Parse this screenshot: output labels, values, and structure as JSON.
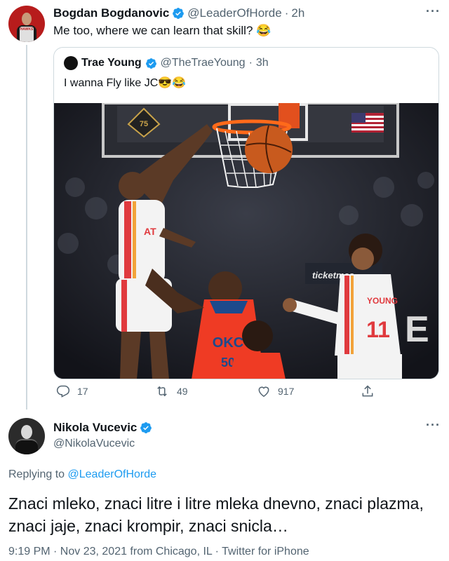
{
  "main_tweet": {
    "display_name": "Bogdan Bogdanovic",
    "handle": "@LeaderOfHorde",
    "dot": "·",
    "time": "2h",
    "text": "Me too, where we can learn that skill? 😂",
    "avatar_jersey": "HAWKS",
    "quoted": {
      "display_name": "Trae Young",
      "handle": "@TheTraeYoung",
      "dot": "·",
      "time": "3h",
      "text": "I wanna Fly like JC😎😂",
      "photo": {
        "backboard_logo": "75",
        "scoreboard_text": "ticketmas",
        "signage_letter": "E",
        "hawks_left_jersey": "AT",
        "okc_jersey_team": "OKC",
        "okc_jersey_number": "50",
        "young_name": "YOUNG",
        "young_number": "11"
      }
    },
    "actions": {
      "reply_count": "17",
      "retweet_count": "49",
      "like_count": "917"
    }
  },
  "reply_tweet": {
    "display_name": "Nikola Vucevic",
    "handle": "@NikolaVucevic",
    "replying_prefix": "Replying to",
    "replying_mention": "@LeaderOfHorde",
    "text": "Znaci mleko, znaci litre i litre mleka dnevno, znaci plazma, znaci jaje, znaci krompir, znaci snicla…",
    "meta": "9:19 PM · Nov 23, 2021 from Chicago, IL · Twitter for iPhone"
  },
  "colors": {
    "verified": "#1d9bf0",
    "link": "#1d9bf0",
    "secondary_text": "#536471",
    "border": "#cfd9de",
    "hawks_red": "#e03a3e",
    "okc_orange": "#ef3b24"
  },
  "icons": [
    "verified-badge-icon",
    "more-icon",
    "reply-icon",
    "retweet-icon",
    "like-icon",
    "share-icon"
  ]
}
